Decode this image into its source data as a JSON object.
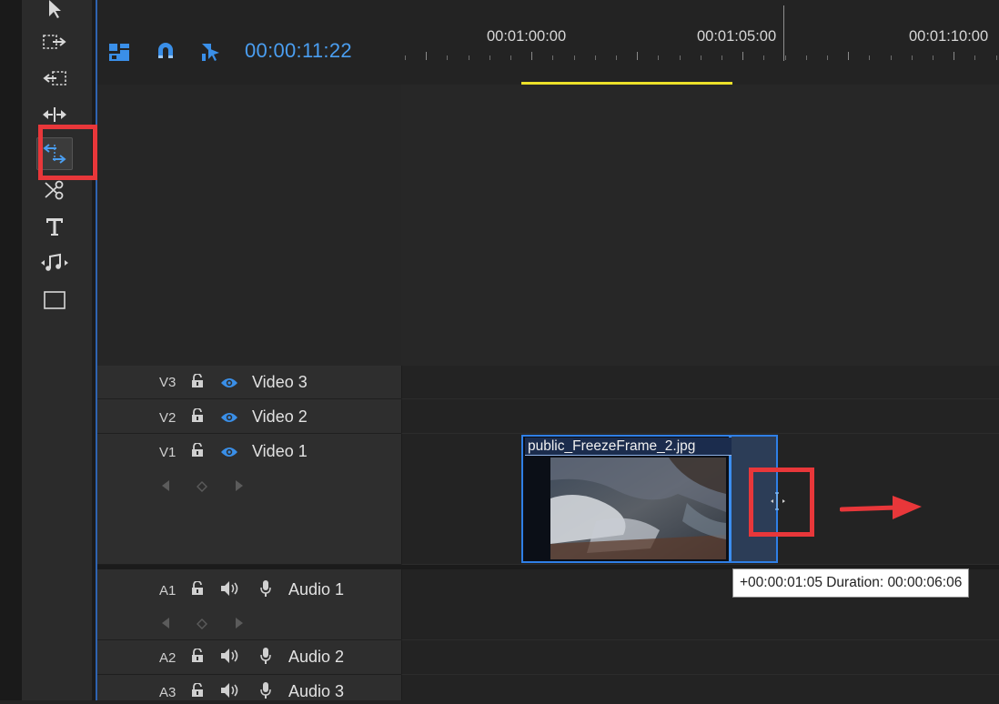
{
  "header": {
    "timecode": "00:00:11:22",
    "ruler_labels": [
      "00:01:00:00",
      "00:01:05:00",
      "00:01:10:00"
    ]
  },
  "tools": [
    {
      "name": "selection-tool-icon"
    },
    {
      "name": "track-select-forward-icon"
    },
    {
      "name": "track-select-backward-icon"
    },
    {
      "name": "ripple-edit-icon"
    },
    {
      "name": "rolling-edit-icon",
      "active": true
    },
    {
      "name": "razor-icon"
    },
    {
      "name": "type-tool-icon"
    },
    {
      "name": "audio-slip-icon"
    },
    {
      "name": "rectangle-tool-icon"
    }
  ],
  "tracks": {
    "video": [
      {
        "id": "V3",
        "name": "Video 3"
      },
      {
        "id": "V2",
        "name": "Video 2"
      },
      {
        "id": "V1",
        "name": "Video 1"
      }
    ],
    "audio": [
      {
        "id": "A1",
        "name": "Audio 1"
      },
      {
        "id": "A2",
        "name": "Audio 2"
      },
      {
        "id": "A3",
        "name": "Audio 3"
      }
    ]
  },
  "clip": {
    "title": "public_FreezeFrame_2.jpg"
  },
  "tooltip": {
    "text": "+00:00:01:05 Duration: 00:00:06:06"
  },
  "colors": {
    "accent": "#4a9ef1",
    "highlight": "#e8373a",
    "work_area": "#ece02a",
    "clip_border": "#2f7fe6"
  }
}
